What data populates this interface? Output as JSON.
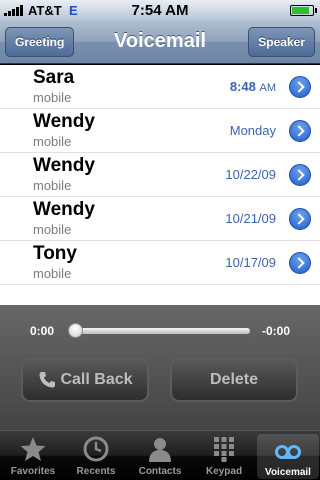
{
  "status": {
    "carrier": "AT&T",
    "network": "E",
    "time": "7:54 AM",
    "battery_level": 0.85,
    "signal_bars": 5
  },
  "navbar": {
    "title": "Voicemail",
    "left_button": "Greeting",
    "right_button": "Speaker"
  },
  "voicemails": [
    {
      "name": "Sara",
      "type": "mobile",
      "time": "8:48",
      "ampm": "AM"
    },
    {
      "name": "Wendy",
      "type": "mobile",
      "date": "Monday"
    },
    {
      "name": "Wendy",
      "type": "mobile",
      "date": "10/22/09"
    },
    {
      "name": "Wendy",
      "type": "mobile",
      "date": "10/21/09"
    },
    {
      "name": "Tony",
      "type": "mobile",
      "date": "10/17/09"
    }
  ],
  "player": {
    "elapsed": "0:00",
    "remaining": "-0:00",
    "progress": 0,
    "call_back_label": "Call Back",
    "delete_label": "Delete"
  },
  "tabs": [
    {
      "label": "Favorites",
      "icon": "star-icon"
    },
    {
      "label": "Recents",
      "icon": "clock-icon"
    },
    {
      "label": "Contacts",
      "icon": "person-icon"
    },
    {
      "label": "Keypad",
      "icon": "keypad-icon"
    },
    {
      "label": "Voicemail",
      "icon": "voicemail-icon",
      "selected": true
    }
  ],
  "colors": {
    "accent_blue": "#3a64b4",
    "nav_bar": "#7a91ae"
  }
}
